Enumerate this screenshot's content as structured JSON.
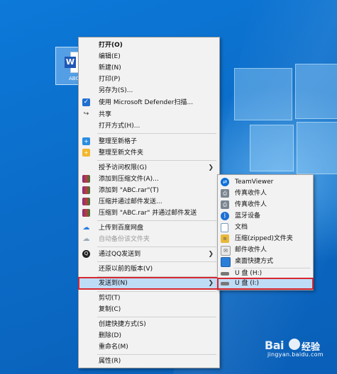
{
  "desktop": {
    "file_label": "ABC",
    "file_badge": "W"
  },
  "context_menu": {
    "items": [
      {
        "label": "打开(O)",
        "icon": "none"
      },
      {
        "label": "编辑(E)",
        "icon": "none"
      },
      {
        "label": "新建(N)",
        "icon": "none"
      },
      {
        "label": "打印(P)",
        "icon": "none"
      },
      {
        "label": "另存为(S)...",
        "icon": "none"
      },
      {
        "label": "使用 Microsoft Defender扫描...",
        "icon": "defender-shield-icon"
      },
      {
        "label": "共享",
        "icon": "share-icon"
      },
      {
        "label": "打开方式(H)...",
        "icon": "none"
      },
      {
        "label": "整理至新格子",
        "icon": "fences-add-icon"
      },
      {
        "label": "整理至新文件夹",
        "icon": "folder-add-icon"
      },
      {
        "label": "授予访问权限(G)",
        "icon": "none"
      },
      {
        "label": "添加到压缩文件(A)...",
        "icon": "winrar-icon"
      },
      {
        "label": "添加到 \"ABC.rar\"(T)",
        "icon": "winrar-icon"
      },
      {
        "label": "压缩并通过邮件发送...",
        "icon": "winrar-icon"
      },
      {
        "label": "压缩到 \"ABC.rar\" 并通过邮件发送",
        "icon": "winrar-icon"
      },
      {
        "label": "上传到百度网盘",
        "icon": "baidu-netdisk-icon"
      },
      {
        "label": "自动备份该文件夹",
        "icon": "baidu-netdisk-icon"
      },
      {
        "label": "通过QQ发送到",
        "icon": "qq-icon"
      },
      {
        "label": "还原以前的版本(V)",
        "icon": "none"
      },
      {
        "label": "发送到(N)",
        "icon": "none"
      },
      {
        "label": "剪切(T)",
        "icon": "none"
      },
      {
        "label": "复制(C)",
        "icon": "none"
      },
      {
        "label": "创建快捷方式(S)",
        "icon": "none"
      },
      {
        "label": "删除(D)",
        "icon": "none"
      },
      {
        "label": "重命名(M)",
        "icon": "none"
      },
      {
        "label": "属性(R)",
        "icon": "none"
      }
    ]
  },
  "send_to_menu": {
    "items": [
      {
        "label": "TeamViewer",
        "icon": "teamviewer-icon"
      },
      {
        "label": "传真收件人",
        "icon": "fax-icon"
      },
      {
        "label": "传真收件人",
        "icon": "fax-icon"
      },
      {
        "label": "蓝牙设备",
        "icon": "bluetooth-icon"
      },
      {
        "label": "文档",
        "icon": "documents-icon"
      },
      {
        "label": "压缩(zipped)文件夹",
        "icon": "zip-folder-icon"
      },
      {
        "label": "邮件收件人",
        "icon": "mail-icon"
      },
      {
        "label": "桌面快捷方式",
        "icon": "desktop-icon"
      },
      {
        "label": "U 盘 (H:)",
        "icon": "usb-drive-icon"
      },
      {
        "label": "U 盘 (I:)",
        "icon": "usb-drive-icon"
      }
    ]
  },
  "watermark": {
    "brand": "Bai",
    "brand_cn": "经验",
    "url": "jingyan.baidu.com"
  },
  "colors": {
    "highlight_outline": "#d8272f",
    "highlight_fill": "#bfdcf6",
    "desktop_blue": "#0b6cc8"
  }
}
